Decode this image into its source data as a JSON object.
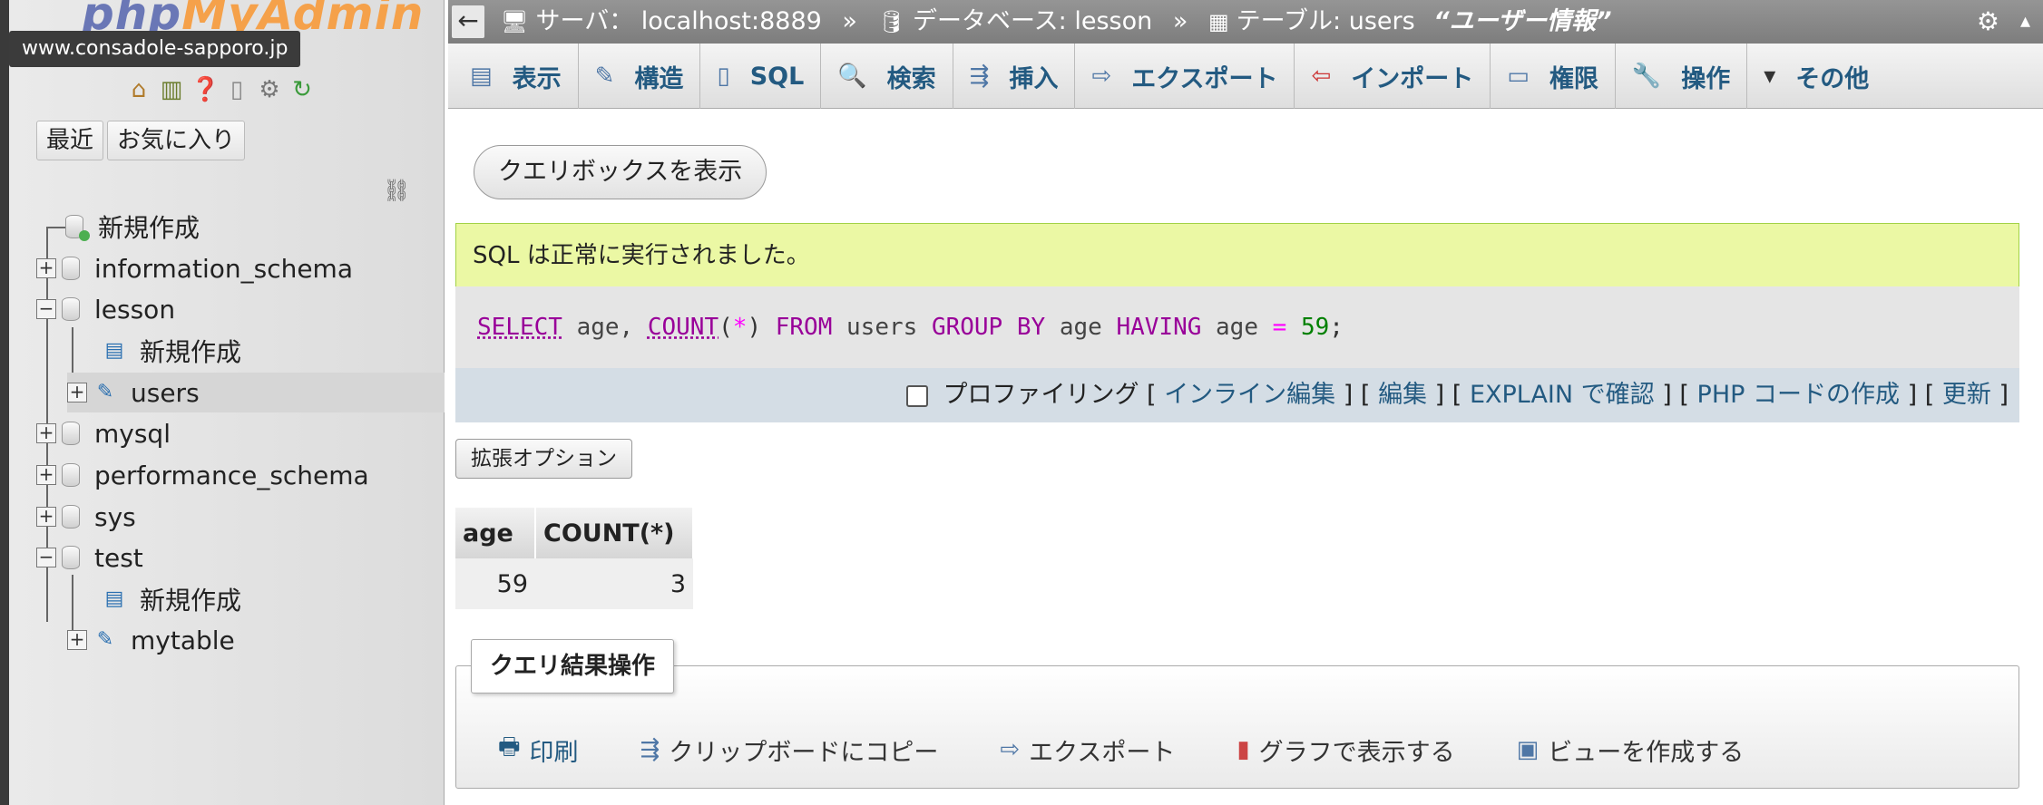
{
  "sidebar": {
    "logo": {
      "part1": "php",
      "part2": "MyAdmin"
    },
    "tooltip": "www.consadole-sapporo.jp",
    "nav_tabs": [
      "最近",
      "お気に入り"
    ],
    "tree": {
      "new": "新規作成",
      "information_schema": "information_schema",
      "lesson": "lesson",
      "lesson_new": "新規作成",
      "users": "users",
      "mysql": "mysql",
      "performance_schema": "performance_schema",
      "sys": "sys",
      "test": "test",
      "test_new": "新規作成",
      "mytable": "mytable"
    },
    "expand_plus": "+",
    "expand_minus": "−"
  },
  "breadcrumb": {
    "server_label": "サーバ：",
    "server": "localhost:8889",
    "sep": "»",
    "db_label": "データベース:",
    "db": "lesson",
    "table_label": "テーブル:",
    "table": "users",
    "comment": "“ユーザー情報”"
  },
  "tabs": [
    {
      "label": "表示",
      "icon": "browse-icon"
    },
    {
      "label": "構造",
      "icon": "structure-icon"
    },
    {
      "label": "SQL",
      "icon": "sql-icon"
    },
    {
      "label": "検索",
      "icon": "search-icon"
    },
    {
      "label": "挿入",
      "icon": "insert-icon"
    },
    {
      "label": "エクスポート",
      "icon": "export-icon"
    },
    {
      "label": "インポート",
      "icon": "import-icon"
    },
    {
      "label": "権限",
      "icon": "privileges-icon"
    },
    {
      "label": "操作",
      "icon": "wrench-icon"
    },
    {
      "label": "その他",
      "icon": "caret-down-icon"
    }
  ],
  "query_box_button": "クエリボックスを表示",
  "success_message": "SQL は正常に実行されました。",
  "sql": {
    "select": "SELECT",
    "col": " age, ",
    "count": "COUNT",
    "lparen": "(",
    "star": "*",
    "rparen": ")",
    "from": " FROM ",
    "table": "users ",
    "groupby": "GROUP BY",
    "col2": " age ",
    "having": "HAVING",
    "col3": " age ",
    "eq": "=",
    "sp": " ",
    "val": "59",
    "semi": ";"
  },
  "sql_options": {
    "profiling": "プロファイリング",
    "lb": "[",
    "rb": "]",
    "inline_edit": "インライン編集",
    "edit": "編集",
    "explain": "EXPLAIN で確認",
    "php_code": "PHP コードの作成",
    "refresh": "更新"
  },
  "ext_options": "拡張オプション",
  "result": {
    "headers": [
      "age",
      "COUNT(*)"
    ],
    "rows": [
      [
        "59",
        "3"
      ]
    ]
  },
  "query_ops": {
    "legend": "クエリ結果操作",
    "print": "印刷",
    "copy": "クリップボードにコピー",
    "export": "エクスポート",
    "chart": "グラフで表示する",
    "view": "ビューを作成する"
  }
}
